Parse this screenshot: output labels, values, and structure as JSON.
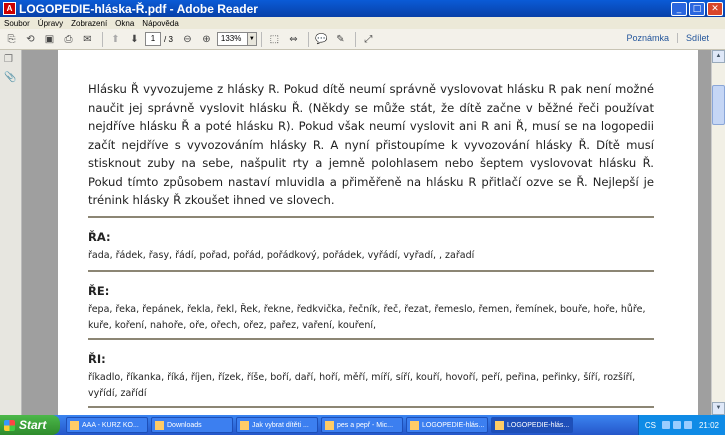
{
  "window": {
    "title": "LOGOPEDIE-hláska-Ř.pdf - Adobe Reader"
  },
  "menu": [
    "Soubor",
    "Úpravy",
    "Zobrazení",
    "Okna",
    "Nápověda"
  ],
  "toolbar": {
    "page_value": "1",
    "page_total": "/ 3",
    "zoom": "133%",
    "comment_label": "Poznámka",
    "share_label": "Sdílet"
  },
  "document": {
    "intro": "Hlásku Ř vyvozujeme z hlásky R. Pokud dítě neumí správně vyslovovat hlásku R pak není možné naučit jej správně vyslovit hlásku Ř. (Někdy se může stát, že dítě začne v běžné řeči používat nejdříve hlásku Ř a poté hlásku R). Pokud však neumí vyslovit ani R ani Ř, musí se na logopedii začít nejdříve s vyvozováním hlásky R. A nyní přistoupíme k vyvozování hlásky Ř. Dítě musí stisknout zuby na sebe, našpulit rty a jemně polohlasem nebo šeptem vyslovovat hlásku Ř. Pokud tímto způsobem nastaví mluvidla a přiměřeně na hlásku R přitlačí ozve se Ř. Nejlepší je trénink hlásky Ř zkoušet ihned ve slovech.",
    "sections": [
      {
        "heading": "ŘA:",
        "words": "řada, řádek, řasy, řádí,  pořad, pořád, pořádkový, pořádek, vyřádí, vyřadí, , zařadí"
      },
      {
        "heading": "ŘE:",
        "words": "řepa, řeka, řepánek, řekla, řekl, Řek, řekne, ředkvička, řečník, řeč, řezat,  řemeslo, řemen, řemínek, bouře, hoře, hůře, kuře, koření, nahoře, oře, ořech, ořez, pařez, vaření, kouření,"
      },
      {
        "heading": "ŘI:",
        "words": "říkadlo, říkanka, říká, říjen,   řízek, říše, boří, daří, hoří, měří, míří, síří, kouří, hovoří, peří, peřina, peřinky, šíří, rozšíří, vyřídí, zařídí"
      }
    ]
  },
  "taskbar": {
    "start_label": "Start",
    "tasks": [
      "AAA - KURZ KO...",
      "Downloads",
      "Jak vybrat dítěti ...",
      "pes a pepř - Mic...",
      "LOGOPEDIE-hlás...",
      "LOGOPEDIE-hlás..."
    ],
    "lang": "CS",
    "clock": "21:02"
  }
}
